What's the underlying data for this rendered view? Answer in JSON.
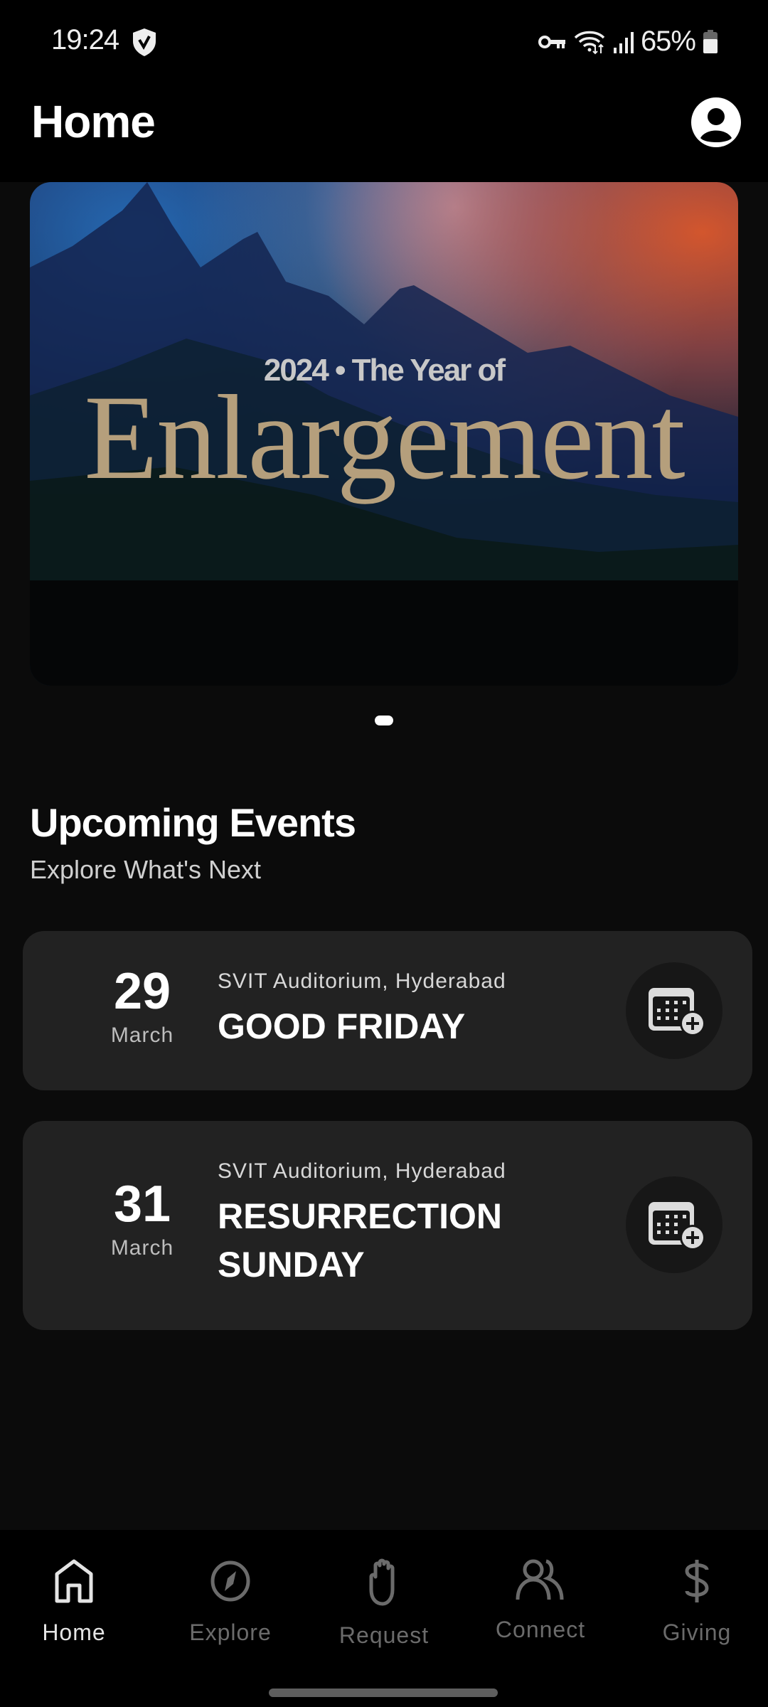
{
  "status_bar": {
    "time": "19:24",
    "battery": "65%",
    "icons": [
      "shield-check-icon",
      "vpn-key-icon",
      "wifi-icon",
      "signal-icon",
      "battery-icon"
    ]
  },
  "header": {
    "title": "Home",
    "profile_icon": "account-circle-icon"
  },
  "banner": {
    "subtitle": "2024 • The Year of",
    "title": "Enlargement",
    "carousel_total": 1,
    "carousel_active": 1
  },
  "events_section": {
    "title": "Upcoming Events",
    "subtitle": "Explore What's Next",
    "events": [
      {
        "day": "29",
        "month": "March",
        "venue": "SVIT Auditorium, Hyderabad",
        "title": "GOOD FRIDAY",
        "action_icon": "calendar-add-icon"
      },
      {
        "day": "31",
        "month": "March",
        "venue": "SVIT Auditorium, Hyderabad",
        "title": "RESURRECTION SUNDAY",
        "action_icon": "calendar-add-icon"
      }
    ]
  },
  "bottom_nav": {
    "items": [
      {
        "label": "Home",
        "icon": "home-icon",
        "active": true
      },
      {
        "label": "Explore",
        "icon": "compass-icon",
        "active": false
      },
      {
        "label": "Request",
        "icon": "hand-icon",
        "active": false
      },
      {
        "label": "Connect",
        "icon": "people-icon",
        "active": false
      },
      {
        "label": "Giving",
        "icon": "dollar-icon",
        "active": false
      }
    ]
  },
  "colors": {
    "background": "#0b0b0b",
    "header": "#000000",
    "card": "#222222",
    "icon_button": "#171717",
    "banner_title": "#b59f7c",
    "nav_inactive": "#6b6b6b",
    "nav_active": "#e4e4e4"
  }
}
